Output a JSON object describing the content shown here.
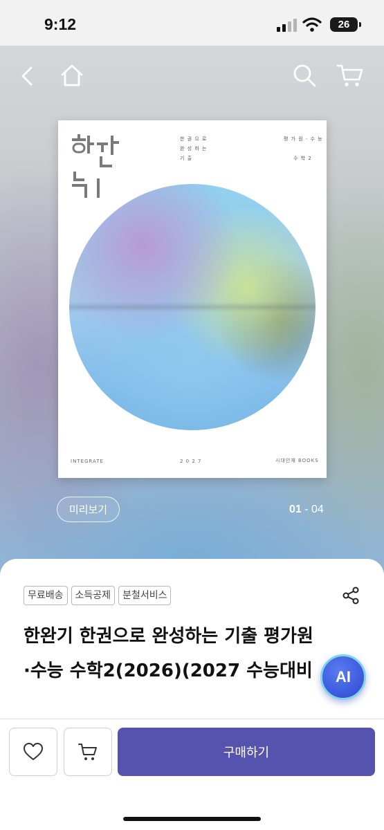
{
  "status": {
    "time": "9:12",
    "battery": "26"
  },
  "nav": {
    "icons": [
      "back-icon",
      "home-icon",
      "search-icon",
      "cart-icon"
    ]
  },
  "cover": {
    "logo_text": "한완기",
    "line1": "한 권 으 로",
    "line2": "완 성 하 는",
    "line3": "기 출",
    "right1": "평 가 원 · 수 능",
    "right2": "수 학 2",
    "footer_left": "INTEGRATE",
    "footer_mid": "2 0 2 7",
    "footer_right": "시대인재 BOOKS"
  },
  "preview": {
    "label": "미리보기",
    "current": "01",
    "separator": " - ",
    "total": "04"
  },
  "badges": [
    "무료배송",
    "소득공제",
    "분철서비스"
  ],
  "product": {
    "title_line1": "한완기 한권으로 완성하는 기출 평가원",
    "title_line2": "·수능 수학2(2026)(2027 수능대비"
  },
  "ai_button": "AI",
  "actions": {
    "buy_label": "구매하기"
  },
  "colors": {
    "accent": "#5553ad",
    "ai": "#3f5fe0"
  }
}
